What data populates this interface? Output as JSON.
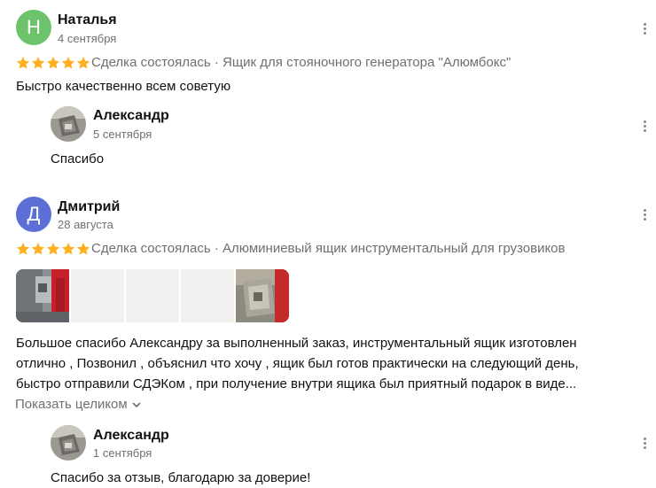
{
  "reviews": [
    {
      "author": "Наталья",
      "avatar_letter": "Н",
      "avatar_color": "#6cc36b",
      "date": "4 сентября",
      "rating": 5,
      "deal_text": "Сделка состоялась · Ящик для стояночного генератора \"Алюмбокс\"",
      "text": "Быстро качественно всем советую",
      "reply": {
        "author": "Александр",
        "date": "5 сентября",
        "text": "Спасибо"
      }
    },
    {
      "author": "Дмитрий",
      "avatar_letter": "Д",
      "avatar_color": "#5b6fd6",
      "date": "28 августа",
      "rating": 5,
      "deal_text": "Сделка состоялась · Алюминиевый ящик инструментальный для грузовиков",
      "text_lines": [
        "Большое спасибо Александру за выполненный заказ, инструментальный ящик изготовлен",
        "отлично , Позвонил , объяснил что хочу , ящик был готов практически на следующий день,",
        "быстро отправили СДЭКом , при получение внутри ящика был приятный подарок в виде..."
      ],
      "show_more": "Показать целиком",
      "reply": {
        "author": "Александр",
        "date": "1 сентября",
        "text": "Спасибо за отзыв, благодарю за доверие!"
      }
    }
  ],
  "colors": {
    "star": "#ffb021",
    "photo_placeholder": "#f2f1ef"
  }
}
